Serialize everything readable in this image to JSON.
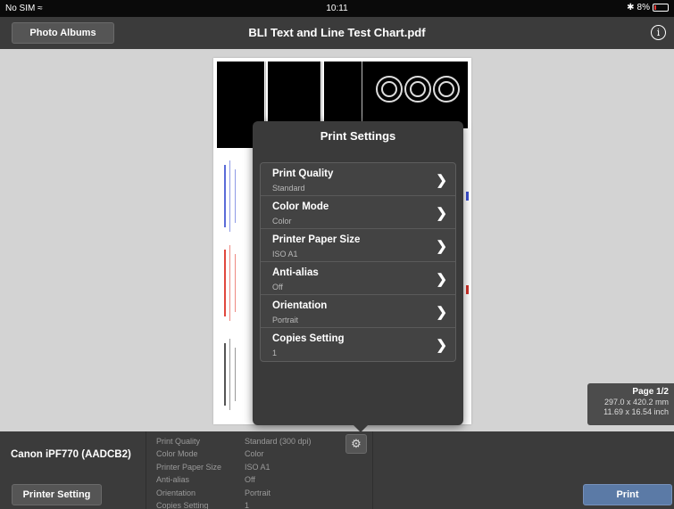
{
  "status_bar": {
    "carrier": "No SIM",
    "wifi_icon": "wifi-icon",
    "time": "10:11",
    "battery": "8%"
  },
  "nav": {
    "back_label": "Photo Albums",
    "title": "BLI Text and Line Test Chart.pdf",
    "info_icon": "i"
  },
  "popover": {
    "title": "Print Settings",
    "items": [
      {
        "label": "Print Quality",
        "value": "Standard"
      },
      {
        "label": "Color Mode",
        "value": "Color"
      },
      {
        "label": "Printer Paper Size",
        "value": "ISO A1"
      },
      {
        "label": "Anti-alias",
        "value": "Off"
      },
      {
        "label": "Orientation",
        "value": "Portrait"
      },
      {
        "label": "Copies Setting",
        "value": "1"
      }
    ]
  },
  "page_info": {
    "page": "Page 1/2",
    "mm": "297.0 x 420.2 mm",
    "inch": "11.69 x 16.54 inch"
  },
  "bottom": {
    "printer_name": "Canon iPF770 (AADCB2)",
    "printer_setting_label": "Printer Setting",
    "print_label": "Print",
    "settings": [
      {
        "key": "Print Quality",
        "value": "Standard (300 dpi)"
      },
      {
        "key": "Color Mode",
        "value": "Color"
      },
      {
        "key": "Printer Paper Size",
        "value": "ISO A1"
      },
      {
        "key": "Anti-alias",
        "value": "Off"
      },
      {
        "key": "Orientation",
        "value": "Portrait"
      },
      {
        "key": "Copies Setting",
        "value": "1"
      }
    ]
  },
  "colors": {
    "accent": "#5b7aa6",
    "bar": "#3b3b3b",
    "popover": "#3a3a3a"
  }
}
